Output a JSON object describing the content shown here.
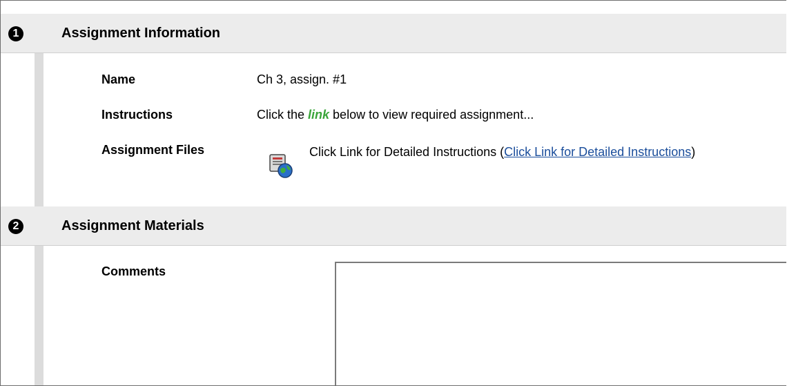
{
  "sections": [
    {
      "step": "1",
      "title": "Assignment Information",
      "fields": {
        "name_label": "Name",
        "name_value": "Ch 3, assign. #1",
        "instructions_label": "Instructions",
        "instructions_prefix": "Click the ",
        "instructions_emphasis": "link",
        "instructions_suffix": " below to view required assignment...",
        "files_label": "Assignment Files",
        "file_text_prefix": "Click Link for Detailed Instructions (",
        "file_link_text": "Click Link for Detailed Instructions",
        "file_text_suffix": ")"
      }
    },
    {
      "step": "2",
      "title": "Assignment Materials",
      "fields": {
        "comments_label": "Comments",
        "comments_value": ""
      }
    }
  ],
  "colors": {
    "header_bg": "#ececec",
    "rail": "#dcdcdc",
    "link": "#1a4d9b",
    "emphasis": "#3aa53a"
  },
  "icons": {
    "file_icon": "web-link-file-icon"
  }
}
